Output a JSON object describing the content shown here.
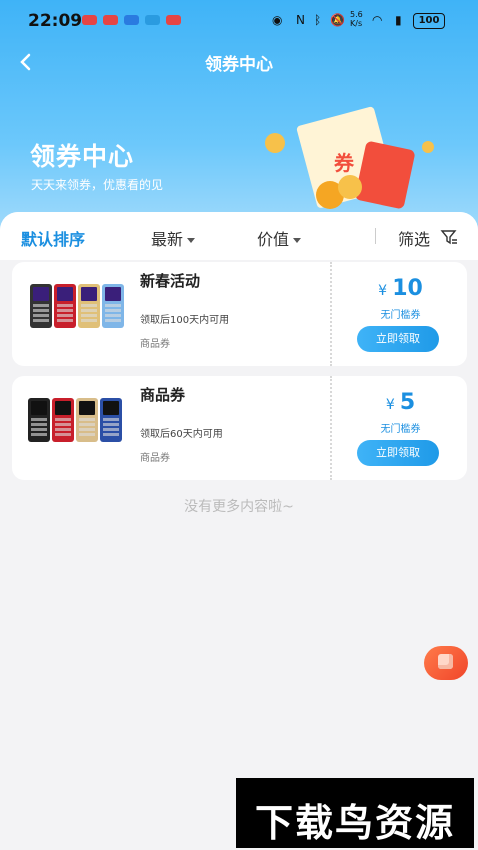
{
  "status_bar": {
    "time": "22:09",
    "network_speed": "5.6\nK/s",
    "battery": "100"
  },
  "navbar": {
    "title": "领券中心"
  },
  "banner": {
    "title": "领券中心",
    "subtitle": "天天来领券，优惠看的见",
    "illustration_text": "券"
  },
  "sort_bar": {
    "default_label": "默认排序",
    "latest_label": "最新",
    "value_label": "价值",
    "filter_label": "筛选"
  },
  "coupons": [
    {
      "name": "新春活动",
      "validity": "领取后100天内可用",
      "kind": "商品券",
      "currency": "¥",
      "amount": "10",
      "threshold": "无门槛券",
      "claim_label": "立即领取"
    },
    {
      "name": "商品券",
      "validity": "领取后60天内可用",
      "kind": "商品券",
      "currency": "¥",
      "amount": "5",
      "threshold": "无门槛券",
      "claim_label": "立即领取"
    }
  ],
  "footer": {
    "no_more": "没有更多内容啦~"
  },
  "watermark": {
    "text": "下载鸟资源"
  },
  "colors": {
    "primary": "#1b8fe0",
    "header": "#3fb3f7",
    "float_button": "#f0452a"
  }
}
